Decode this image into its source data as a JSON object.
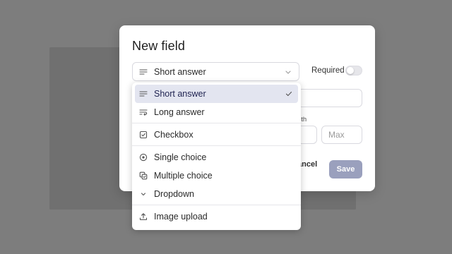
{
  "modal": {
    "title": "New field",
    "type_select": {
      "value": "Short answer",
      "icon": "short-answer-icon"
    },
    "required_label": "Required",
    "required_enabled": false,
    "length_label_partial": "gth",
    "max_placeholder": "Max",
    "cancel_label_partial": "ancel",
    "save_label": "Save",
    "save_color": "#9aa0bd"
  },
  "dropdown": {
    "groups": [
      [
        {
          "label": "Short answer",
          "icon": "short-answer-icon",
          "selected": true
        },
        {
          "label": "Long answer",
          "icon": "long-answer-icon",
          "selected": false
        }
      ],
      [
        {
          "label": "Checkbox",
          "icon": "checkbox-icon",
          "selected": false
        }
      ],
      [
        {
          "label": "Single choice",
          "icon": "radio-icon",
          "selected": false
        },
        {
          "label": "Multiple choice",
          "icon": "multiple-choice-icon",
          "selected": false
        },
        {
          "label": "Dropdown",
          "icon": "chevron-down-icon",
          "selected": false
        }
      ],
      [
        {
          "label": "Image upload",
          "icon": "upload-icon",
          "selected": false
        }
      ]
    ],
    "selected_bg": "#e3e5f0"
  }
}
